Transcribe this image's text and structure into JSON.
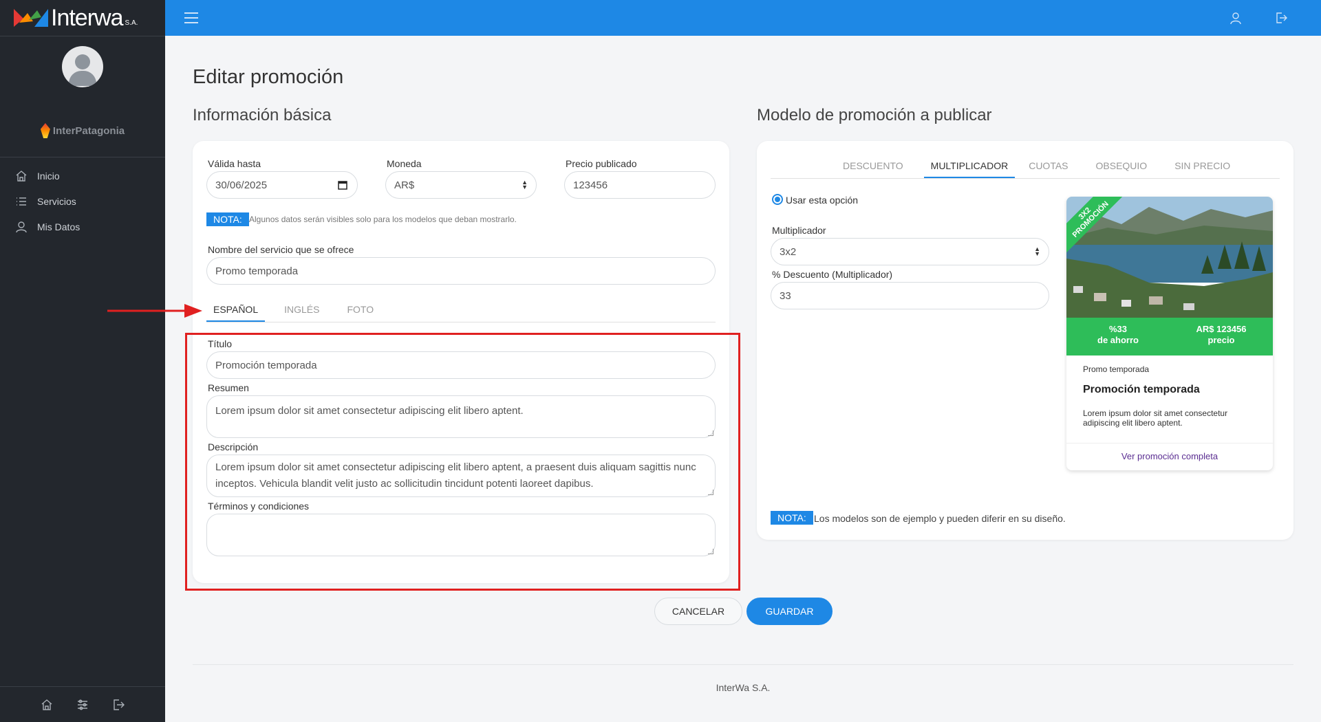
{
  "brand": {
    "name": "Interwa",
    "suffix": "S.A."
  },
  "company": {
    "name": "InterPatagonia"
  },
  "sidebar": {
    "items": [
      {
        "label": "Inicio",
        "icon": "home-icon"
      },
      {
        "label": "Servicios",
        "icon": "list-icon"
      },
      {
        "label": "Mis Datos",
        "icon": "user-icon"
      }
    ]
  },
  "page": {
    "title": "Editar promoción"
  },
  "basic": {
    "section_title": "Información básica",
    "valid_until_label": "Válida hasta",
    "valid_until_value": "30/06/2025",
    "currency_label": "Moneda",
    "currency_value": "AR$",
    "price_label": "Precio publicado",
    "price_value": "123456",
    "nota_badge": "NOTA:",
    "nota_text": "Algunos datos serán visibles solo para los modelos que deban mostrarlo.",
    "service_label": "Nombre del servicio que se ofrece",
    "service_value": "Promo temporada",
    "tabs": [
      {
        "label": "ESPAÑOL",
        "active": true
      },
      {
        "label": "INGLÉS",
        "active": false
      },
      {
        "label": "FOTO",
        "active": false
      }
    ],
    "title_label": "Título",
    "title_value": "Promoción temporada",
    "summary_label": "Resumen",
    "summary_value": "Lorem ipsum dolor sit amet consectetur adipiscing elit libero aptent.",
    "description_label": "Descripción",
    "description_value": "Lorem ipsum dolor sit amet consectetur adipiscing elit libero aptent, a praesent duis aliquam sagittis nunc inceptos. Vehicula blandit velit justo ac sollicitudin tincidunt potenti laoreet dapibus.",
    "terms_label": "Términos y condiciones",
    "terms_value": ""
  },
  "model": {
    "section_title": "Modelo de promoción a publicar",
    "tabs": [
      {
        "label": "DESCUENTO",
        "active": false
      },
      {
        "label": "MULTIPLICADOR",
        "active": true
      },
      {
        "label": "CUOTAS",
        "active": false
      },
      {
        "label": "OBSEQUIO",
        "active": false
      },
      {
        "label": "SIN PRECIO",
        "active": false
      }
    ],
    "use_option_label": "Usar esta opción",
    "multiplier_label": "Multiplicador",
    "multiplier_value": "3x2",
    "discount_label": "% Descuento (Multiplicador)",
    "discount_value": "33",
    "nota_badge": "NOTA:",
    "nota_text": "Los modelos son de ejemplo y pueden diferir en su diseño."
  },
  "preview": {
    "ribbon_line1": "3X2",
    "ribbon_line2": "PROMOCIÓN",
    "saving_value": "%33",
    "saving_label": "de ahorro",
    "price_value": "AR$ 123456",
    "price_label": "precio",
    "service": "Promo temporada",
    "title": "Promoción temporada",
    "summary": "Lorem ipsum dolor sit amet consectetur adipiscing elit libero aptent.",
    "link": "Ver promoción completa"
  },
  "actions": {
    "cancel": "CANCELAR",
    "save": "GUARDAR"
  },
  "footer": {
    "text": "InterWa S.A."
  },
  "colors": {
    "primary": "#1e88e5",
    "sidebar": "#23272d",
    "success": "#2ebd59",
    "highlight": "#e02020"
  }
}
